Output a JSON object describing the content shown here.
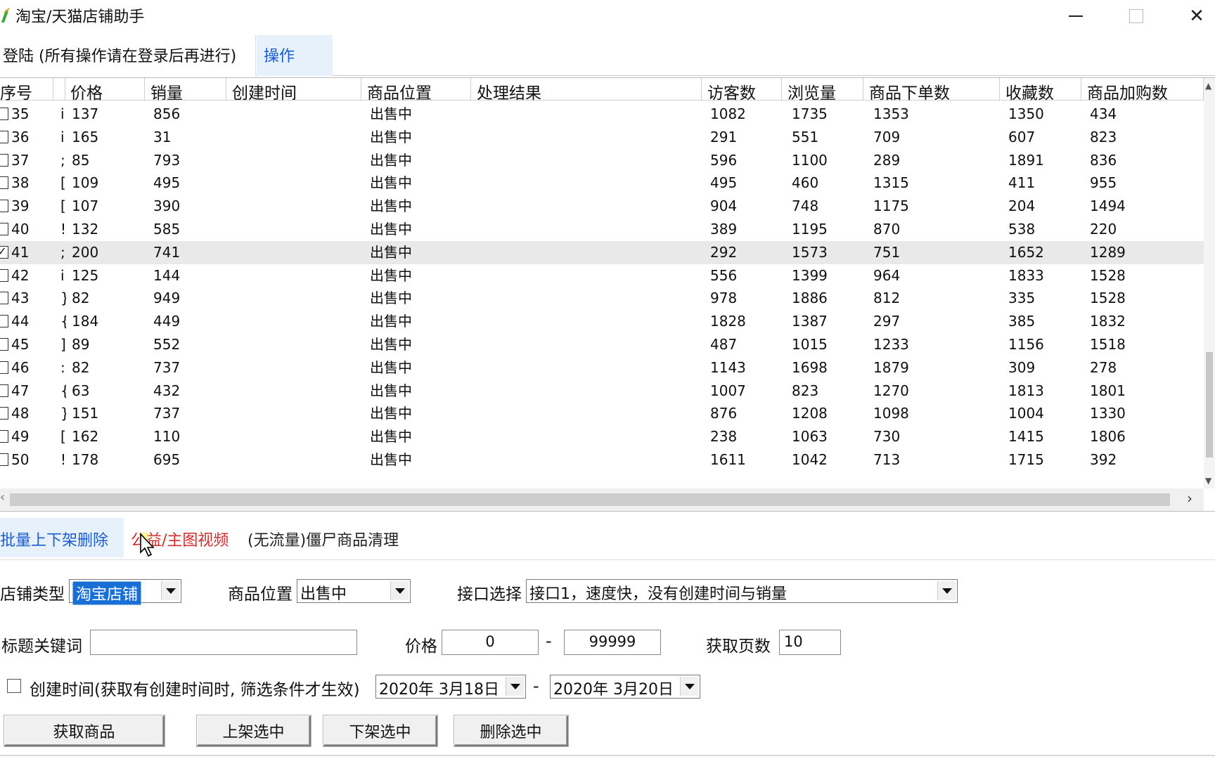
{
  "window": {
    "title": "淘宝/天猫店铺助手",
    "minimize_glyph": "—",
    "close_glyph": "✕"
  },
  "top_tabs": [
    {
      "label": "登陆 (所有操作请在登录后再进行)"
    },
    {
      "label": "操作"
    }
  ],
  "table": {
    "columns": [
      "序号",
      "价格",
      "销量",
      "创建时间",
      "商品位置",
      "处理结果",
      "访客数",
      "浏览量",
      "商品下单数",
      "收藏数",
      "商品加购数"
    ],
    "rows": [
      {
        "id": "35",
        "frag": "i",
        "price": "137",
        "sales": "856",
        "location": "出售中",
        "visitors": "1082",
        "views": "1735",
        "orders": "1353",
        "favorites": "1350",
        "carts": "434",
        "checked": false
      },
      {
        "id": "36",
        "frag": "i",
        "price": "165",
        "sales": "31",
        "location": "出售中",
        "visitors": "291",
        "views": "551",
        "orders": "709",
        "favorites": "607",
        "carts": "823",
        "checked": false
      },
      {
        "id": "37",
        "frag": ";",
        "price": "85",
        "sales": "793",
        "location": "出售中",
        "visitors": "596",
        "views": "1100",
        "orders": "289",
        "favorites": "1891",
        "carts": "836",
        "checked": false
      },
      {
        "id": "38",
        "frag": "[",
        "price": "109",
        "sales": "495",
        "location": "出售中",
        "visitors": "495",
        "views": "460",
        "orders": "1315",
        "favorites": "411",
        "carts": "955",
        "checked": false
      },
      {
        "id": "39",
        "frag": "[",
        "price": "107",
        "sales": "390",
        "location": "出售中",
        "visitors": "904",
        "views": "748",
        "orders": "1175",
        "favorites": "204",
        "carts": "1494",
        "checked": false
      },
      {
        "id": "40",
        "frag": "!",
        "price": "132",
        "sales": "585",
        "location": "出售中",
        "visitors": "389",
        "views": "1195",
        "orders": "870",
        "favorites": "538",
        "carts": "220",
        "checked": false
      },
      {
        "id": "41",
        "frag": ";",
        "price": "200",
        "sales": "741",
        "location": "出售中",
        "visitors": "292",
        "views": "1573",
        "orders": "751",
        "favorites": "1652",
        "carts": "1289",
        "checked": true
      },
      {
        "id": "42",
        "frag": "i",
        "price": "125",
        "sales": "144",
        "location": "出售中",
        "visitors": "556",
        "views": "1399",
        "orders": "964",
        "favorites": "1833",
        "carts": "1528",
        "checked": false
      },
      {
        "id": "43",
        "frag": "}",
        "price": "82",
        "sales": "949",
        "location": "出售中",
        "visitors": "978",
        "views": "1886",
        "orders": "812",
        "favorites": "335",
        "carts": "1528",
        "checked": false
      },
      {
        "id": "44",
        "frag": "{",
        "price": "184",
        "sales": "449",
        "location": "出售中",
        "visitors": "1828",
        "views": "1387",
        "orders": "297",
        "favorites": "385",
        "carts": "1832",
        "checked": false
      },
      {
        "id": "45",
        "frag": "]",
        "price": "89",
        "sales": "552",
        "location": "出售中",
        "visitors": "487",
        "views": "1015",
        "orders": "1233",
        "favorites": "1156",
        "carts": "1518",
        "checked": false
      },
      {
        "id": "46",
        "frag": ":",
        "price": "82",
        "sales": "737",
        "location": "出售中",
        "visitors": "1143",
        "views": "1698",
        "orders": "1879",
        "favorites": "309",
        "carts": "278",
        "checked": false
      },
      {
        "id": "47",
        "frag": "{",
        "price": "63",
        "sales": "432",
        "location": "出售中",
        "visitors": "1007",
        "views": "823",
        "orders": "1270",
        "favorites": "1813",
        "carts": "1801",
        "checked": false
      },
      {
        "id": "48",
        "frag": "}",
        "price": "151",
        "sales": "737",
        "location": "出售中",
        "visitors": "876",
        "views": "1208",
        "orders": "1098",
        "favorites": "1004",
        "carts": "1330",
        "checked": false
      },
      {
        "id": "49",
        "frag": "[",
        "price": "162",
        "sales": "110",
        "location": "出售中",
        "visitors": "238",
        "views": "1063",
        "orders": "730",
        "favorites": "1415",
        "carts": "1806",
        "checked": false
      },
      {
        "id": "50",
        "frag": "!",
        "price": "178",
        "sales": "695",
        "location": "出售中",
        "visitors": "1611",
        "views": "1042",
        "orders": "713",
        "favorites": "1715",
        "carts": "392",
        "checked": false
      }
    ]
  },
  "bottom_tabs": [
    {
      "label": "批量上下架删除"
    },
    {
      "label": "公益/主图视频"
    },
    {
      "label": "(无流量)僵尸商品清理"
    }
  ],
  "form": {
    "shop_type_label": "店铺类型",
    "shop_type_value": "淘宝店铺",
    "location_label": "商品位置",
    "location_value": "出售中",
    "api_label": "接口选择",
    "api_value": "接口1，速度快，没有创建时间与销量",
    "keyword_label": "标题关键词",
    "keyword_value": "",
    "price_label": "价格",
    "price_min": "0",
    "price_max": "99999",
    "range_dash": "-",
    "pages_label": "获取页数",
    "pages_value": "10",
    "created_label": "创建时间(获取有创建时间时, 筛选条件才生效)",
    "date_from": "2020年  3月18日",
    "date_to": "2020年  3月20日"
  },
  "buttons": {
    "fetch": "获取商品",
    "list_on": "上架选中",
    "list_off": "下架选中",
    "delete": "删除选中"
  },
  "colors": {
    "tab_active_bg": "#e6f1fb",
    "tab_active_text": "#1a5cd0",
    "tab_red_text": "#d12b2b",
    "selection_blue": "#1a6fd6"
  }
}
